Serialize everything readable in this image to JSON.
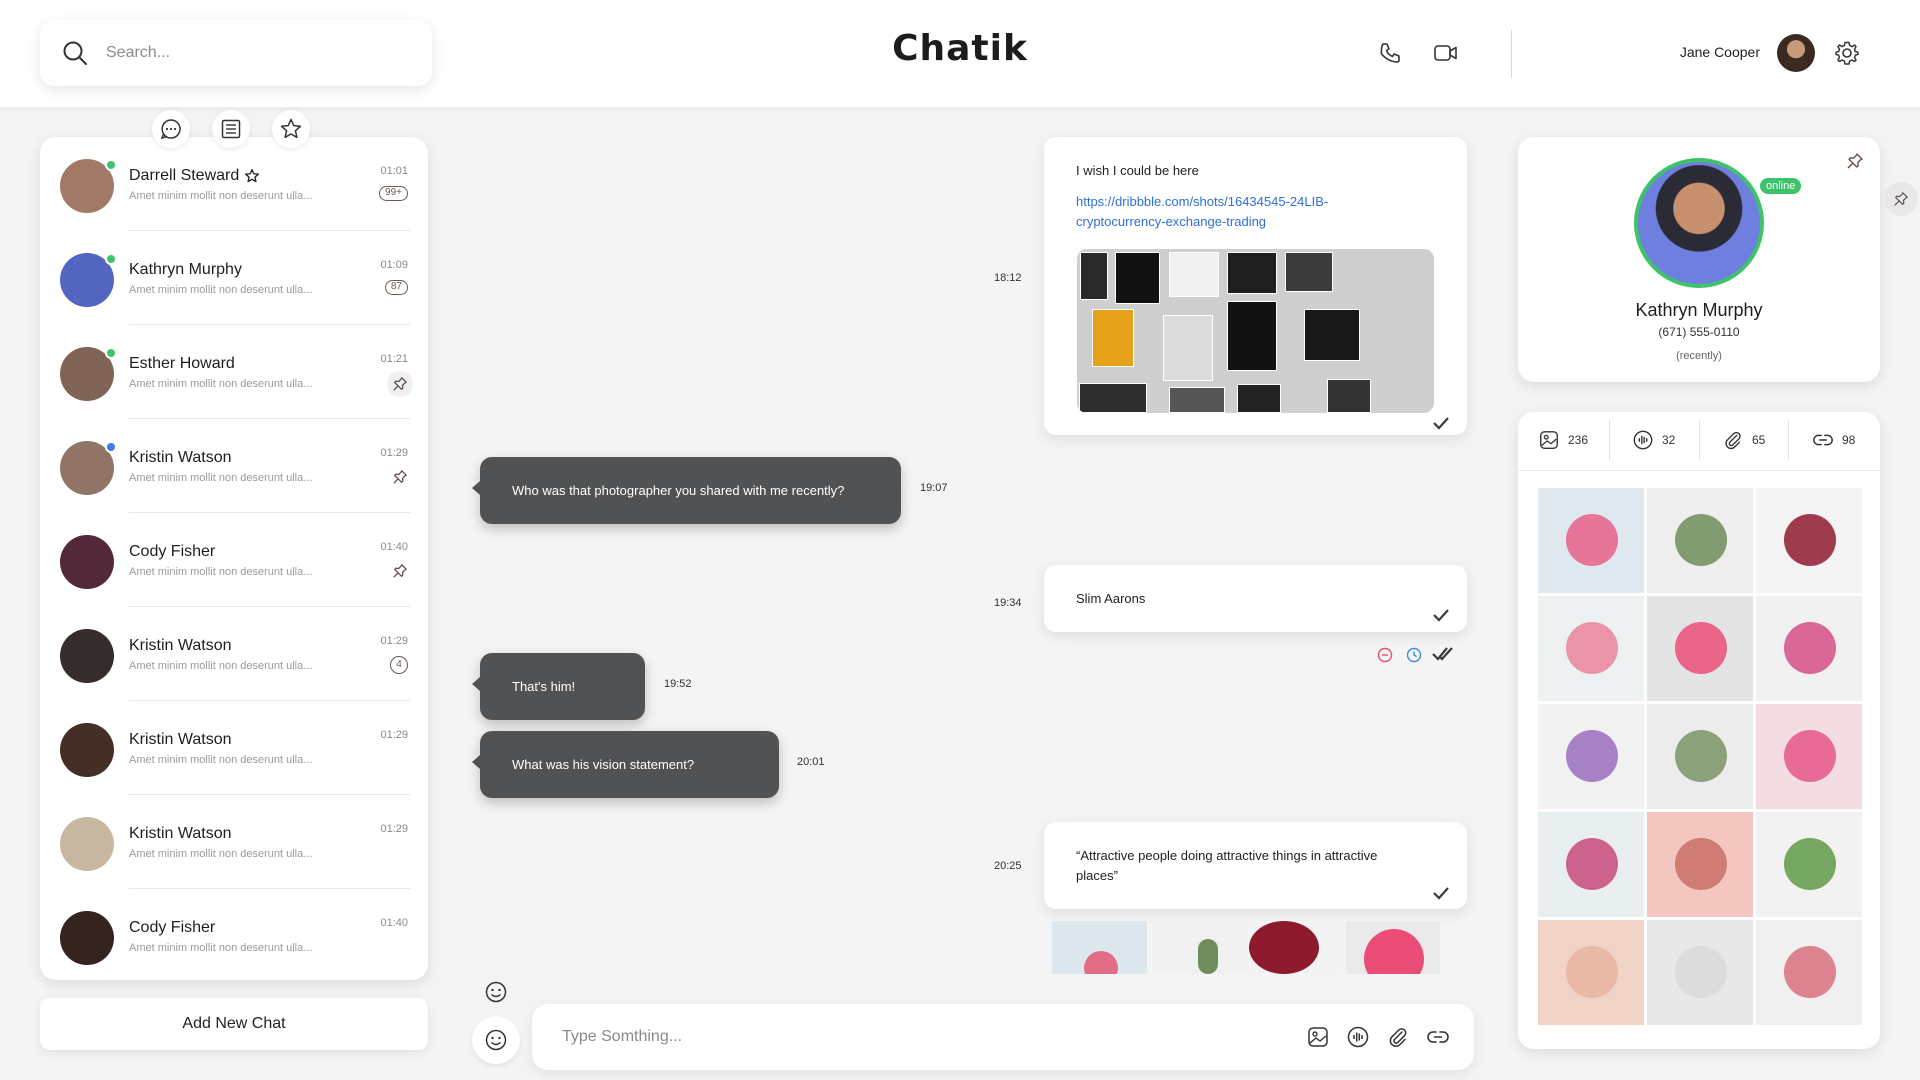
{
  "app": {
    "logo": "Chatik"
  },
  "header": {
    "search_placeholder": "Search...",
    "username": "Jane Cooper"
  },
  "chat_list": [
    {
      "name": "Darrell Steward",
      "preview": "Amet minim mollit non deserunt ulla...",
      "time": "01:01",
      "badge": "99+",
      "status": "online",
      "starred": true,
      "avatar_color": "#b08470"
    },
    {
      "name": "Kathryn Murphy",
      "preview": "Amet minim mollit non deserunt ulla...",
      "time": "01:09",
      "badge": "87",
      "status": "online",
      "avatar_color": "#5a6fd0"
    },
    {
      "name": "Esther Howard",
      "preview": "Amet minim mollit non deserunt ulla...",
      "time": "01:21",
      "pin": "circle",
      "status": "online",
      "avatar_color": "#8a6c5c"
    },
    {
      "name": "Kristin Watson",
      "preview": "Amet minim mollit non deserunt ulla...",
      "time": "01:29",
      "pin": "plain",
      "status": "away",
      "avatar_color": "#9c7f6f"
    },
    {
      "name": "Cody Fisher",
      "preview": "Amet minim mollit non deserunt ulla...",
      "time": "01:40",
      "pin": "plain",
      "status": "none",
      "avatar_color": "#5b2b40"
    },
    {
      "name": "Kristin Watson",
      "preview": "Amet minim mollit non deserunt ulla...",
      "time": "01:29",
      "badge": "4",
      "status": "none",
      "avatar_color": "#3a3030"
    },
    {
      "name": "Kristin Watson",
      "preview": "Amet minim mollit non deserunt ulla...",
      "time": "01:29",
      "status": "none",
      "avatar_color": "#4a3228"
    },
    {
      "name": "Kristin Watson",
      "preview": "Amet minim mollit non deserunt ulla...",
      "time": "01:29",
      "status": "none",
      "avatar_color": "#d9c8b0"
    },
    {
      "name": "Cody Fisher",
      "preview": "Amet minim mollit non deserunt ulla...",
      "time": "01:40",
      "status": "none",
      "avatar_color": "#3a2620"
    }
  ],
  "add_chat_label": "Add New Chat",
  "messages": {
    "m1": {
      "text": "I wish I could be here",
      "link": "https://dribbble.com/shots/16434545-24LIB-cryptocurrency-exchange-trading",
      "link_line1": "https://dribbble.com/shots/16434545-24LIB-",
      "link_line2": "cryptocurrency-exchange-trading",
      "time": "18:12"
    },
    "m2": {
      "text": "Who was that photographer you shared with me recently?",
      "time": "19:07"
    },
    "m3": {
      "text": "Slim Aarons",
      "time": "19:34"
    },
    "m4": {
      "text": "That's him!",
      "time": "19:52"
    },
    "m5": {
      "text": "What was his vision statement?",
      "time": "20:01"
    },
    "m6": {
      "line1": "“Attractive people doing attractive things in attractive",
      "line2": "places”",
      "time": "20:25"
    }
  },
  "composer": {
    "placeholder": "Type Somthing..."
  },
  "profile": {
    "name": "Kathryn Murphy",
    "phone": "(671) 555-0110",
    "status_text": "(recently)",
    "online_label": "online"
  },
  "media_tabs": [
    {
      "icon": "image-icon",
      "count": "236"
    },
    {
      "icon": "audio-icon",
      "count": "32"
    },
    {
      "icon": "attachment-icon",
      "count": "65"
    },
    {
      "icon": "link-icon",
      "count": "98"
    }
  ],
  "colors": {
    "accent_green": "#3ec36b",
    "dark_bubble": "#505254",
    "link_blue": "#2f6fd6"
  }
}
